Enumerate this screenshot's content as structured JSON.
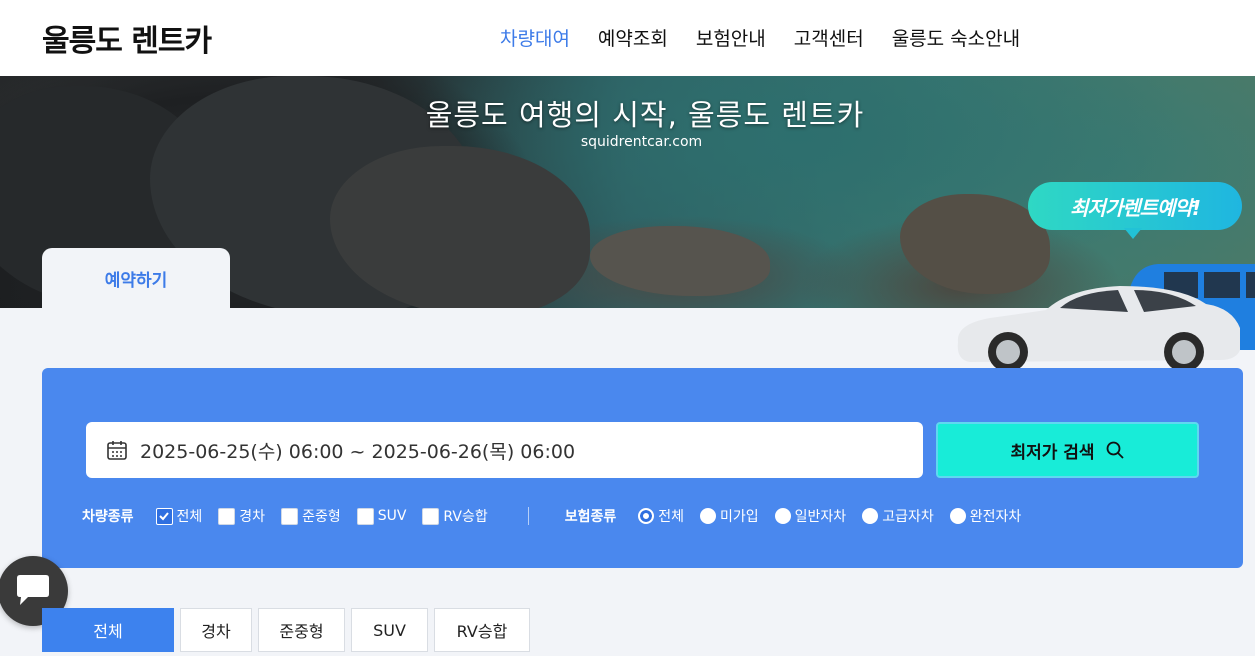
{
  "header": {
    "logo": "울릉도 렌트카",
    "nav": [
      "차량대여",
      "예약조회",
      "보험안내",
      "고객센터",
      "울릉도 숙소안내"
    ],
    "active_nav": "차량대여"
  },
  "hero": {
    "title": "울릉도 여행의 시작, 울릉도 렌트카",
    "subtitle": "squidrentcar.com",
    "promo": "최저가렌트예약!",
    "tab": "예약하기"
  },
  "search": {
    "date_range": "2025-06-25(수) 06:00 ~ 2025-06-26(목) 06:00",
    "button_label": "최저가 검색",
    "vehicle_filter": {
      "label": "차량종류",
      "options": [
        {
          "label": "전체",
          "checked": true
        },
        {
          "label": "경차",
          "checked": false
        },
        {
          "label": "준중형",
          "checked": false
        },
        {
          "label": "SUV",
          "checked": false
        },
        {
          "label": "RV승합",
          "checked": false
        }
      ]
    },
    "insurance_filter": {
      "label": "보험종류",
      "options": [
        {
          "label": "전체",
          "checked": true
        },
        {
          "label": "미가입",
          "checked": false
        },
        {
          "label": "일반자차",
          "checked": false
        },
        {
          "label": "고급자차",
          "checked": false
        },
        {
          "label": "완전자차",
          "checked": false
        }
      ]
    }
  },
  "category_tabs": [
    "전체",
    "경차",
    "준중형",
    "SUV",
    "RV승합"
  ],
  "colors": {
    "accent": "#3d7be8",
    "panel": "#4a88ee",
    "search_button": "#18ecd8",
    "promo_start": "#2fd8c4",
    "promo_end": "#1fb6e0"
  }
}
